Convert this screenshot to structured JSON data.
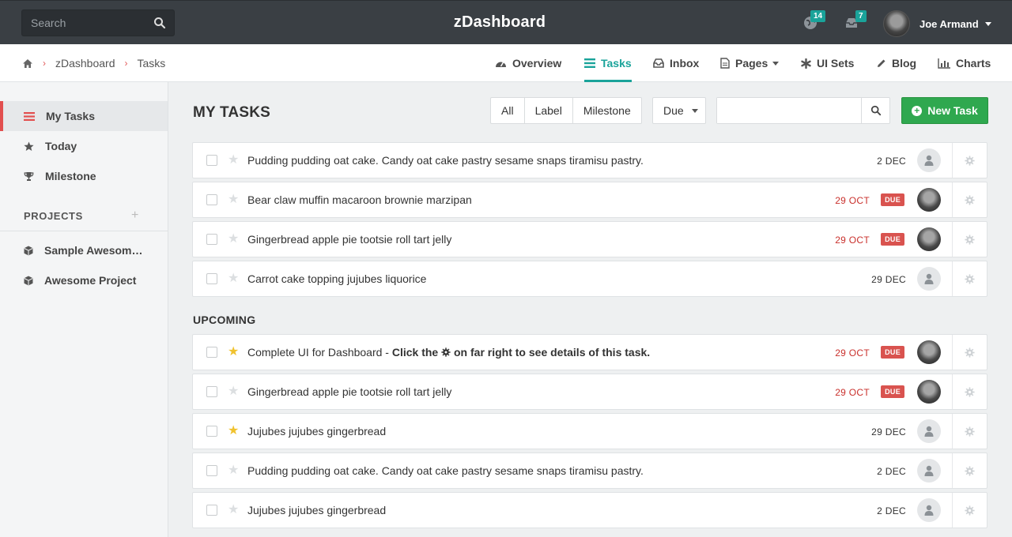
{
  "topbar": {
    "search_placeholder": "Search",
    "brand": "zDashboard",
    "notifications_count": "14",
    "messages_count": "7",
    "user_name": "Joe Armand"
  },
  "breadcrumb": [
    "zDashboard",
    "Tasks"
  ],
  "nav": [
    {
      "label": "Overview",
      "icon": "dashboard-icon"
    },
    {
      "label": "Tasks",
      "icon": "tasks-icon",
      "active": true
    },
    {
      "label": "Inbox",
      "icon": "inbox-icon"
    },
    {
      "label": "Pages",
      "icon": "page-icon"
    },
    {
      "label": "UI Sets",
      "icon": "asterisk-icon"
    },
    {
      "label": "Blog",
      "icon": "pencil-icon"
    },
    {
      "label": "Charts",
      "icon": "bar-chart-icon"
    }
  ],
  "sidebar": {
    "items": [
      {
        "label": "My Tasks",
        "icon": "tasks-icon",
        "active": true
      },
      {
        "label": "Today",
        "icon": "star-icon"
      },
      {
        "label": "Milestone",
        "icon": "trophy-icon"
      }
    ],
    "projects_heading": "PROJECTS",
    "projects": [
      {
        "label": "Sample Awesome Project",
        "icon": "cube-icon"
      },
      {
        "label": "Awesome Project",
        "icon": "cube-icon"
      }
    ]
  },
  "main": {
    "title": "MY TASKS",
    "filters": [
      "All",
      "Label",
      "Milestone"
    ],
    "sort_label": "Due",
    "new_task_label": "New Task",
    "upcoming_heading": "UPCOMING",
    "colors": {
      "accent": "#1aa39a",
      "success": "#2fa84f",
      "danger": "#d9534f",
      "star": "#f0c22e"
    },
    "tasks": [
      {
        "text": "Pudding pudding oat cake. Candy oat cake pastry sesame snaps tiramisu pastry.",
        "date": "2 DEC",
        "due": false,
        "starred": false,
        "assignee": "placeholder"
      },
      {
        "text": "Bear claw muffin macaroon brownie marzipan",
        "date": "29 OCT",
        "due": true,
        "due_label": "DUE",
        "starred": false,
        "assignee": "photo"
      },
      {
        "text": "Gingerbread apple pie tootsie roll tart jelly",
        "date": "29 OCT",
        "due": true,
        "due_label": "DUE",
        "starred": false,
        "assignee": "photo"
      },
      {
        "text": "Carrot cake topping jujubes liquorice",
        "date": "29 DEC",
        "due": false,
        "starred": false,
        "assignee": "placeholder"
      }
    ],
    "upcoming": [
      {
        "text": "Complete UI for Dashboard - ",
        "bold_pre": "Click the ",
        "bold_post": " on far right to see details of this task.",
        "date": "29 OCT",
        "due": true,
        "due_label": "DUE",
        "starred": true,
        "assignee": "photo"
      },
      {
        "text": "Gingerbread apple pie tootsie roll tart jelly",
        "date": "29 OCT",
        "due": true,
        "due_label": "DUE",
        "starred": false,
        "assignee": "photo"
      },
      {
        "text": "Jujubes jujubes gingerbread",
        "date": "29 DEC",
        "due": false,
        "starred": true,
        "assignee": "placeholder"
      },
      {
        "text": "Pudding pudding oat cake. Candy oat cake pastry sesame snaps tiramisu pastry.",
        "date": "2 DEC",
        "due": false,
        "starred": false,
        "assignee": "placeholder"
      },
      {
        "text": "Jujubes jujubes gingerbread",
        "date": "2 DEC",
        "due": false,
        "starred": false,
        "assignee": "placeholder"
      }
    ]
  }
}
